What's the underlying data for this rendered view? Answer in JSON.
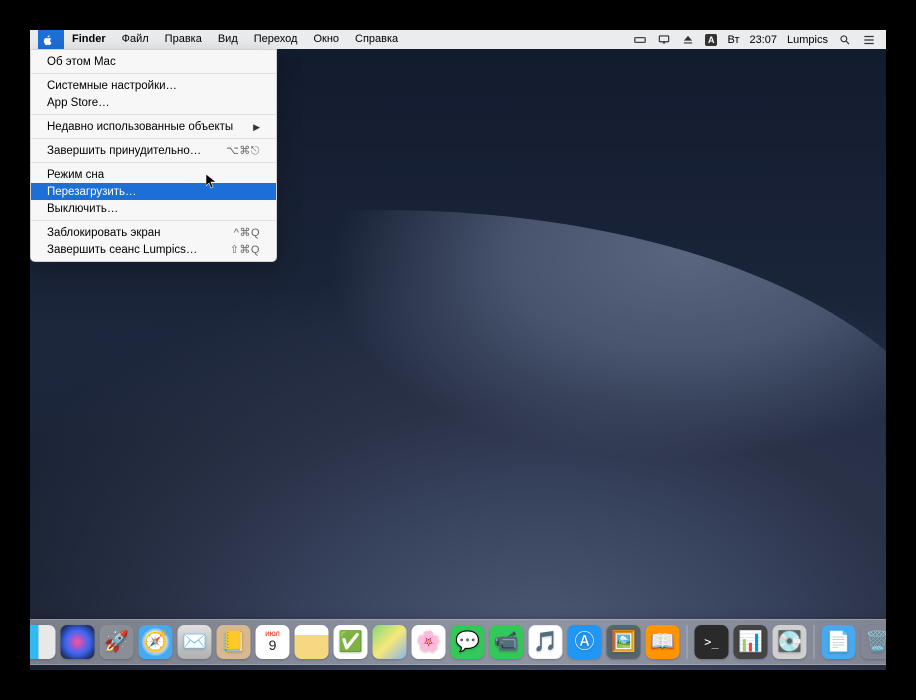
{
  "menubar": {
    "app": "Finder",
    "items": [
      "Файл",
      "Правка",
      "Вид",
      "Переход",
      "Окно",
      "Справка"
    ],
    "right": {
      "input_badge": "А",
      "day": "Вт",
      "time": "23:07",
      "user": "Lumpics"
    }
  },
  "apple_menu": {
    "about": "Об этом Mac",
    "preferences": "Системные настройки…",
    "appstore": "App Store…",
    "recent": "Недавно использованные объекты",
    "forcequit": "Завершить принудительно…",
    "forcequit_sc": "⌥⌘⎋",
    "sleep": "Режим сна",
    "restart": "Перезагрузить…",
    "shutdown": "Выключить…",
    "lock": "Заблокировать экран",
    "lock_sc": "^⌘Q",
    "logout": "Завершить сеанс Lumpics…",
    "logout_sc": "⇧⌘Q"
  },
  "calendar": {
    "month": "ИЮЛ",
    "day": "9"
  },
  "dock_items": [
    "finder",
    "siri",
    "launchpad",
    "safari",
    "mail",
    "contacts",
    "calendar",
    "notes",
    "reminders",
    "maps",
    "photos",
    "messages",
    "facetime",
    "itunes",
    "appstore",
    "preview",
    "books",
    "terminal",
    "activity",
    "bootcamp",
    "doc",
    "trash"
  ]
}
